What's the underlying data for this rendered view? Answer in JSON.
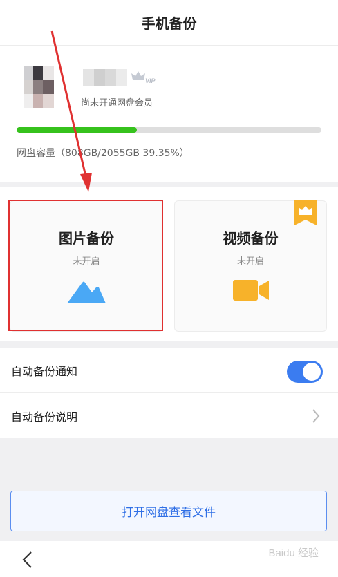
{
  "header": {
    "title": "手机备份"
  },
  "profile": {
    "vip_label": "VIP",
    "member_status": "尚未开通网盘会员",
    "storage": {
      "used_fraction": 0.3935,
      "capacity_text": "网盘容量（808GB/2055GB 39.35%）"
    },
    "colors": {
      "progress": "#36c21d",
      "track": "#dedede"
    }
  },
  "backup_cards": [
    {
      "title": "图片备份",
      "status": "未开启",
      "icon": "mountain-photo-icon",
      "color": "#4aa8f5"
    },
    {
      "title": "视频备份",
      "status": "未开启",
      "icon": "video-camera-icon",
      "color": "#f7b22a",
      "badge": "crown-icon"
    }
  ],
  "settings": {
    "auto_notify": {
      "label": "自动备份通知",
      "enabled": true
    },
    "auto_description": {
      "label": "自动备份说明"
    }
  },
  "open_files_button": {
    "label": "打开网盘查看文件"
  },
  "bottom_bar": {
    "back_icon": "chevron-left-icon",
    "watermark": "Baidu 经验"
  },
  "colors": {
    "accent": "#3b7cf0",
    "highlight": "#e03131",
    "badge": "#f7b22a"
  }
}
